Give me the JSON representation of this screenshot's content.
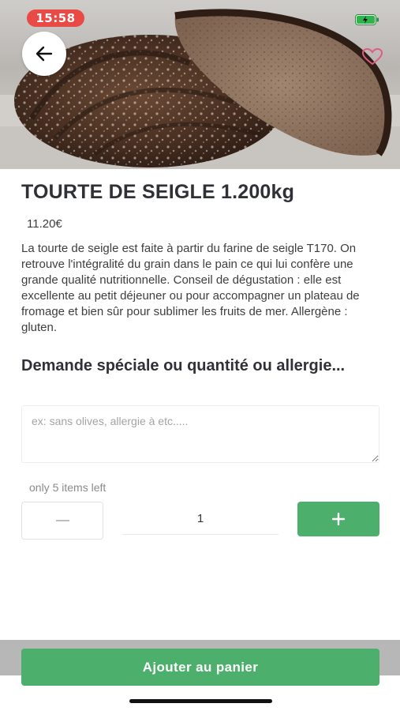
{
  "status_bar": {
    "time": "15:58"
  },
  "product": {
    "title": "TOURTE DE SEIGLE 1.200kg",
    "price": "11.20€",
    "description": "La tourte de seigle est faite à partir du farine de seigle T170. On retrouve l'intégralité du grain dans le pain ce qui lui confère une grande qualité nutritionnelle. Conseil de dégustation : elle est excellente au petit déjeuner ou pour accompagner un plateau de fromage et bien sûr pour sublimer les fruits de mer. Allergène : gluten."
  },
  "special_request": {
    "heading": "Demande spéciale ou quantité ou allergie...",
    "placeholder": "ex: sans olives, allergie à etc.....",
    "value": ""
  },
  "stock": {
    "text": "only 5 items left"
  },
  "quantity": {
    "value": "1",
    "minus_icon": "minus-icon",
    "plus_icon": "plus-icon"
  },
  "actions": {
    "add_to_cart_label": "Ajouter au panier"
  },
  "icons": {
    "back": "arrow-left-icon",
    "favorite": "heart-outline-icon",
    "battery": "battery-charging-icon"
  },
  "colors": {
    "accent_green": "#4caf6b",
    "time_pill_red": "#e94a45",
    "heart_pink": "#e05a86"
  }
}
